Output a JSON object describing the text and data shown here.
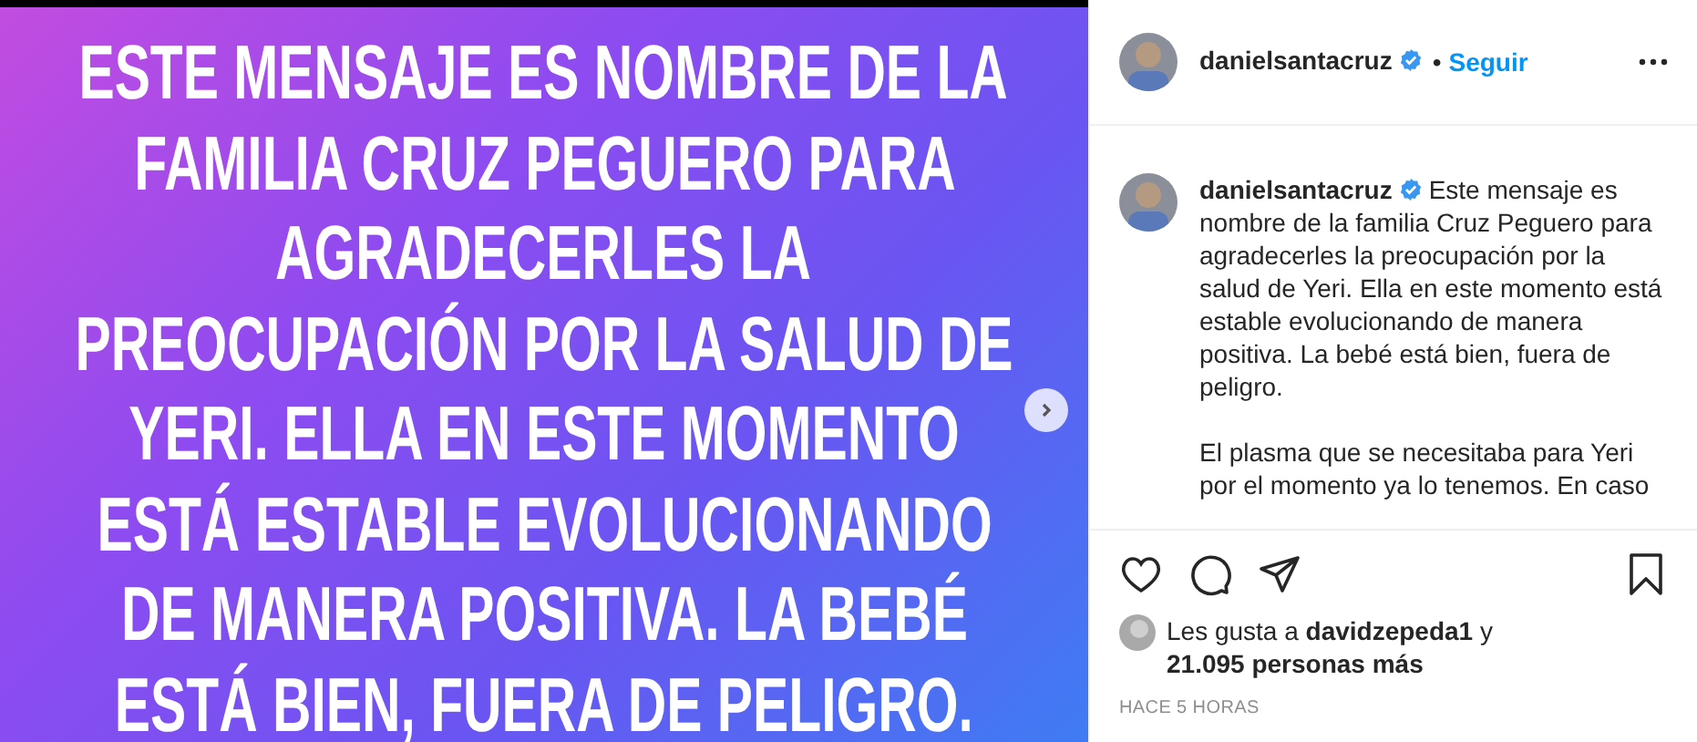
{
  "post_image": {
    "lines": [
      "ESTE MENSAJE ES NOMBRE DE LA",
      "FAMILIA CRUZ PEGUERO PARA",
      "AGRADECERLES LA",
      "PREOCUPACIÓN POR LA SALUD DE",
      "YERI. ELLA EN ESTE MOMENTO",
      "ESTÁ ESTABLE EVOLUCIONANDO",
      "DE MANERA POSITIVA. LA BEBÉ",
      "ESTÁ BIEN, FUERA DE PELIGRO."
    ]
  },
  "header": {
    "username": "danielsantacruz",
    "verified": true,
    "separator": "•",
    "follow": "Seguir"
  },
  "caption": {
    "username": "danielsantacruz",
    "verified": true,
    "paragraphs": [
      "Este mensaje es nombre de la familia Cruz Peguero para agradecerles la preocupación por la salud de Yeri. Ella en este momento está estable evolucionando de manera positiva. La bebé está bien, fuera de peligro.",
      "El plasma que se necesitaba para Yeri por el momento ya lo tenemos. En caso"
    ]
  },
  "likes": {
    "prefix": "Les gusta a",
    "user": "davidzepeda1",
    "suffix": "y",
    "count": "21.095 personas más"
  },
  "time": "HACE 5 HORAS"
}
